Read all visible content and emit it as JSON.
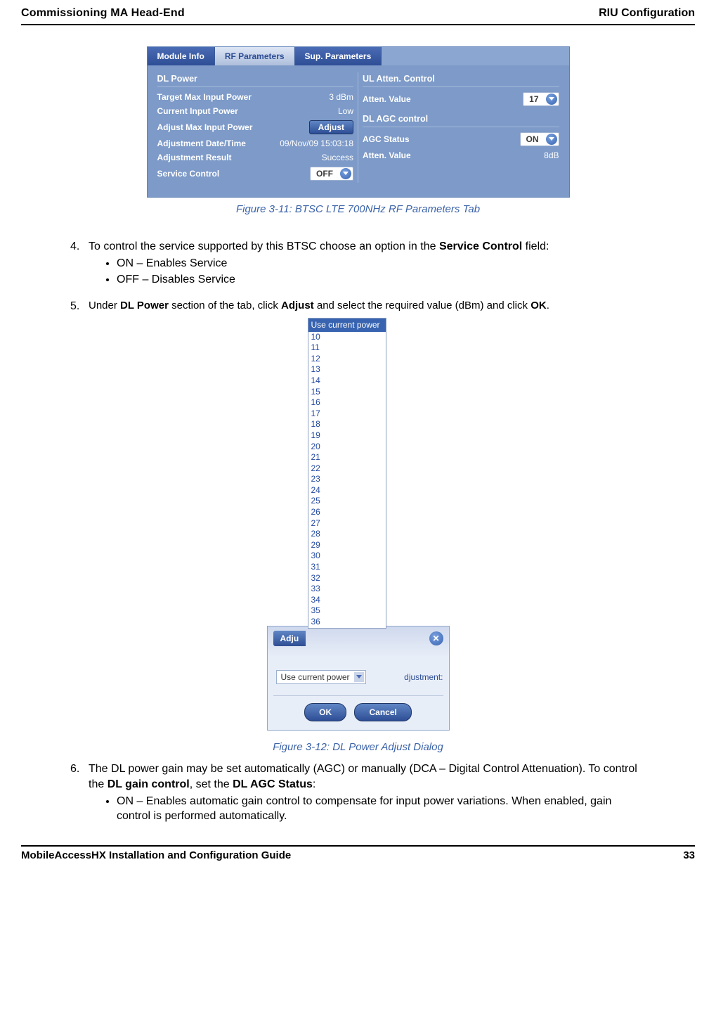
{
  "header": {
    "left": "Commissioning MA Head-End",
    "right": "RIU Configuration"
  },
  "footer": {
    "left": "MobileAccessHX Installation and Configuration Guide",
    "right": "33"
  },
  "figure1": {
    "caption": "Figure 3-11: BTSC LTE 700NHz RF Parameters Tab",
    "tabs": {
      "module_info": "Module Info",
      "rf_parameters": "RF Parameters",
      "sup_parameters": "Sup. Parameters"
    },
    "dl_power": {
      "title": "DL Power",
      "target_max_label": "Target Max Input Power",
      "target_max_val": "3 dBm",
      "current_label": "Current Input Power",
      "current_val": "Low",
      "adjust_max_label": "Adjust Max Input Power",
      "adjust_btn": "Adjust",
      "adj_dt_label": "Adjustment Date/Time",
      "adj_dt_val": "09/Nov/09 15:03:18",
      "adj_res_label": "Adjustment Result",
      "adj_res_val": "Success",
      "svc_ctrl_label": "Service Control",
      "svc_ctrl_val": "OFF"
    },
    "ul_atten": {
      "title": "UL Atten. Control",
      "atten_label": "Atten. Value",
      "atten_val": "17"
    },
    "dl_agc": {
      "title": "DL AGC control",
      "status_label": "AGC Status",
      "status_val": "ON",
      "atten_label": "Atten. Value",
      "atten_val": "8dB"
    }
  },
  "steps": {
    "s4": {
      "num": "4.",
      "text_a": "To control the service supported by this BTSC choose an option in the ",
      "bold_a": "Service Control",
      "text_b": " field:",
      "b1": "ON – Enables Service",
      "b2": "OFF – Disables Service"
    },
    "s5": {
      "num": "5.",
      "text_a": "Under ",
      "bold_a": "DL Power",
      "text_b": " section of the tab, click ",
      "bold_b": "Adjust",
      "text_c": " and select the required value (dBm) and click ",
      "bold_c": "OK",
      "text_d": "."
    },
    "s6": {
      "num": "6.",
      "text_a": "The DL power gain may be set automatically (AGC) or manually (DCA – Digital Control Attenuation). To control the ",
      "bold_a": "DL gain control",
      "text_b": ", set the ",
      "bold_b": "DL AGC Status",
      "text_c": ":",
      "b1": "ON – Enables automatic gain control to compensate for input power variations. When enabled, gain control is performed automatically."
    }
  },
  "figure2": {
    "caption": "Figure 3-12: DL Power Adjust Dialog",
    "list_top": "Use current power",
    "list": [
      "10",
      "11",
      "12",
      "13",
      "14",
      "15",
      "16",
      "17",
      "18",
      "19",
      "20",
      "21",
      "22",
      "23",
      "24",
      "25",
      "26",
      "27",
      "28",
      "29",
      "30",
      "31",
      "32",
      "33",
      "34",
      "35",
      "36"
    ],
    "dialog": {
      "title_prefix": "Adju",
      "right_hint": "djustment:",
      "select_val": "Use current power",
      "ok": "OK",
      "cancel": "Cancel"
    }
  }
}
